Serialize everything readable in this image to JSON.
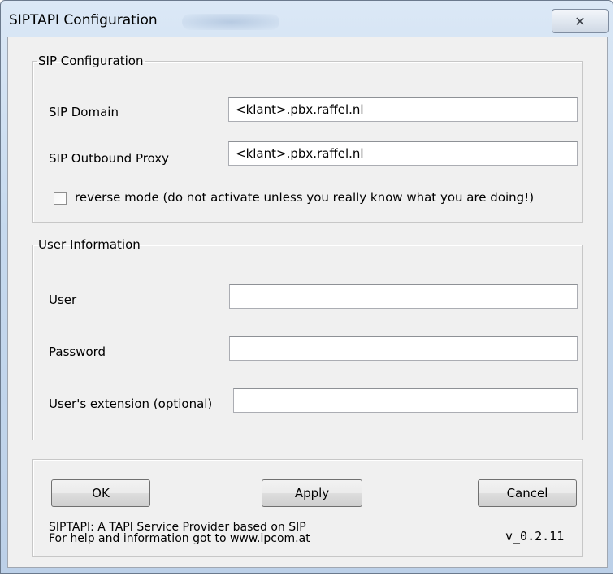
{
  "window": {
    "title": "SIPTAPI Configuration",
    "close_icon": "✕"
  },
  "sip_group": {
    "legend": "SIP Configuration",
    "domain_label": "SIP Domain",
    "domain_value": "<klant>.pbx.raffel.nl",
    "proxy_label": "SIP Outbound Proxy",
    "proxy_value": "<klant>.pbx.raffel.nl",
    "reverse_mode_label": "reverse mode (do not activate unless you really know what you are doing!)",
    "reverse_mode_checked": false
  },
  "user_group": {
    "legend": "User Information",
    "user_label": "User",
    "user_value": "",
    "password_label": "Password",
    "password_value": "",
    "extension_label": "User's extension (optional)",
    "extension_value": ""
  },
  "footer": {
    "ok_label": "OK",
    "apply_label": "Apply",
    "cancel_label": "Cancel",
    "info_line1": "SIPTAPI: A TAPI Service Provider based on SIP",
    "info_line2": "For help and information got to www.ipcom.at",
    "version": "v_0.2.11"
  }
}
